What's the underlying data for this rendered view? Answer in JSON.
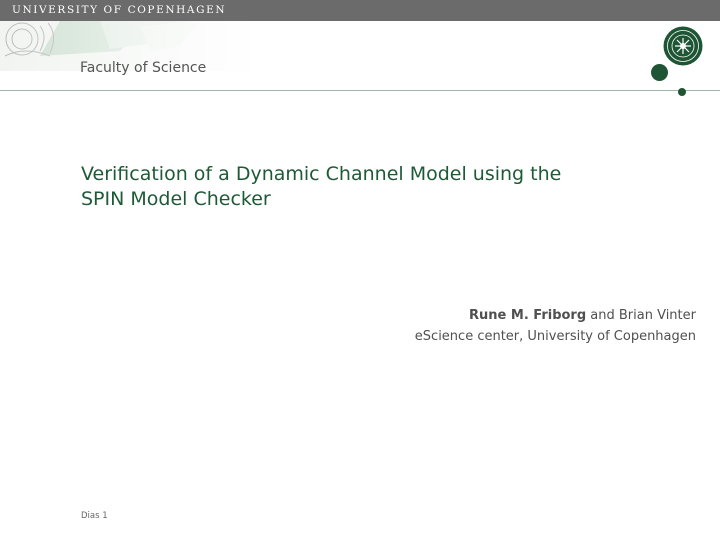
{
  "header": {
    "university": "UNIVERSITY OF COPENHAGEN",
    "faculty": "Faculty of Science"
  },
  "slide": {
    "title_line1": "Verification of a Dynamic Channel Model using the",
    "title_line2": "SPIN Model Checker",
    "author_primary": "Rune M. Friborg",
    "author_rest": " and Brian Vinter",
    "affiliation": "eScience center, University of Copenhagen",
    "slide_number": "Dias 1"
  },
  "colors": {
    "brand_green": "#1e5534",
    "title_green": "#1f5a37",
    "top_bar": "#6b6b6b"
  }
}
